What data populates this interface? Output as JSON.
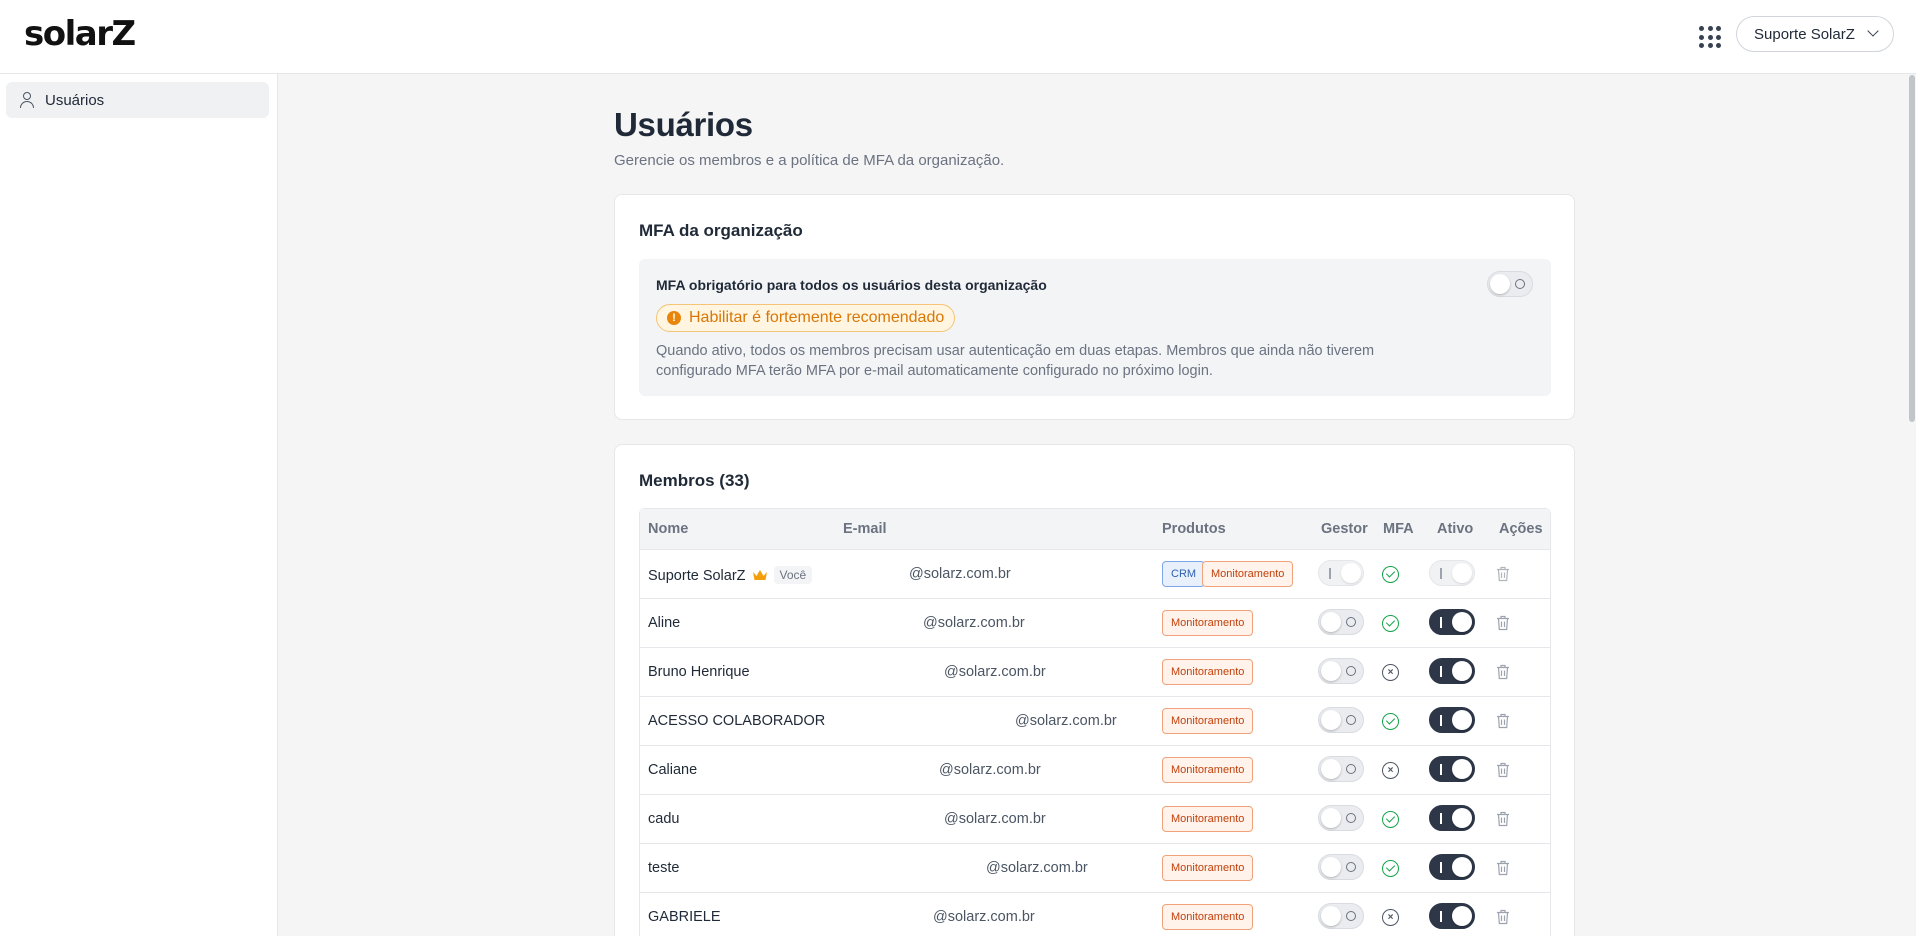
{
  "header": {
    "logo": "solarZ",
    "org_select": "Suporte SolarZ"
  },
  "sidebar": {
    "items": [
      {
        "label": "Usuários",
        "icon": "user-icon"
      }
    ]
  },
  "page": {
    "title": "Usuários",
    "subtitle": "Gerencie os membros e a política de MFA da organização."
  },
  "mfa_card": {
    "title": "MFA da organização",
    "label": "MFA obrigatório para todos os usuários desta organização",
    "badge": "Habilitar é fortemente recomendado",
    "description": "Quando ativo, todos os membros precisam usar autenticação em duas etapas. Membros que ainda não tiverem configurado MFA terão MFA por e-mail automaticamente configurado no próximo login.",
    "enabled": false
  },
  "members": {
    "title": "Membros (33)",
    "columns": [
      "Nome",
      "E-mail",
      "Produtos",
      "Gestor",
      "MFA",
      "Ativo",
      "Ações"
    ],
    "you_label": "Você",
    "rows": [
      {
        "name": "Suporte SolarZ",
        "email": "@solarz.com.br",
        "products": [
          "CRM",
          "Monitoramento"
        ],
        "gestor": false,
        "mfa": true,
        "ativo": true,
        "is_you": true
      },
      {
        "name": "Aline",
        "email": "@solarz.com.br",
        "products": [
          "Monitoramento"
        ],
        "gestor": false,
        "mfa": true,
        "ativo": true
      },
      {
        "name": "Bruno Henrique",
        "email": "@solarz.com.br",
        "products": [
          "Monitoramento"
        ],
        "gestor": false,
        "mfa": false,
        "ativo": true
      },
      {
        "name": "ACESSO COLABORADOR",
        "email": "@solarz.com.br",
        "products": [
          "Monitoramento"
        ],
        "gestor": false,
        "mfa": true,
        "ativo": true
      },
      {
        "name": "Caliane",
        "email": "@solarz.com.br",
        "products": [
          "Monitoramento"
        ],
        "gestor": false,
        "mfa": false,
        "ativo": true
      },
      {
        "name": "cadu",
        "email": "@solarz.com.br",
        "products": [
          "Monitoramento"
        ],
        "gestor": false,
        "mfa": true,
        "ativo": true
      },
      {
        "name": "teste",
        "email": "@solarz.com.br",
        "products": [
          "Monitoramento"
        ],
        "gestor": false,
        "mfa": true,
        "ativo": true
      },
      {
        "name": "GABRIELE",
        "email": "@solarz.com.br",
        "products": [
          "Monitoramento"
        ],
        "gestor": false,
        "mfa": false,
        "ativo": true
      }
    ]
  },
  "colors": {
    "accent_dark": "#2d3748",
    "success": "#16a34a",
    "warning": "#d97706",
    "crm": "#2d5fb3",
    "monitoramento": "#c2410c"
  }
}
